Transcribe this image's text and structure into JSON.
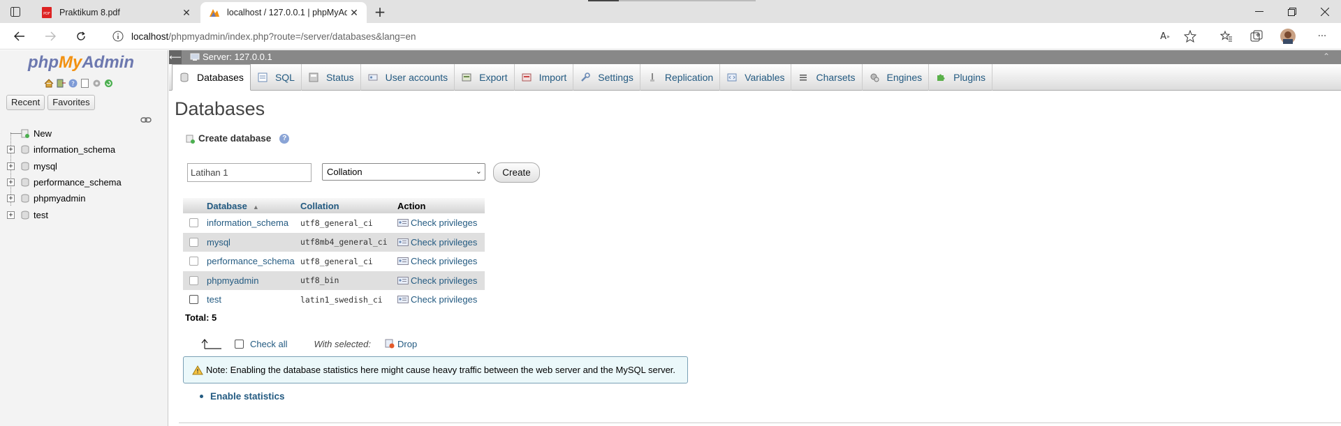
{
  "browser": {
    "tabs": [
      {
        "title": "Praktikum 8.pdf",
        "active": false
      },
      {
        "title": "localhost / 127.0.0.1 | phpMyAdmin",
        "active": true
      }
    ],
    "url_host": "localhost",
    "url_path": "/phpmyadmin/index.php?route=/server/databases&lang=en"
  },
  "nav": {
    "logo_php": "php",
    "logo_my": "My",
    "logo_admin": "Admin",
    "recent_label": "Recent",
    "favorites_label": "Favorites",
    "tree": [
      {
        "label": "New"
      },
      {
        "label": "information_schema"
      },
      {
        "label": "mysql"
      },
      {
        "label": "performance_schema"
      },
      {
        "label": "phpmyadmin"
      },
      {
        "label": "test"
      }
    ]
  },
  "server_bar": {
    "label": "Server: 127.0.0.1"
  },
  "main_tabs": [
    {
      "label": "Databases",
      "icon": "database-icon"
    },
    {
      "label": "SQL",
      "icon": "sql-icon"
    },
    {
      "label": "Status",
      "icon": "status-icon"
    },
    {
      "label": "User accounts",
      "icon": "users-icon"
    },
    {
      "label": "Export",
      "icon": "export-icon"
    },
    {
      "label": "Import",
      "icon": "import-icon"
    },
    {
      "label": "Settings",
      "icon": "settings-icon"
    },
    {
      "label": "Replication",
      "icon": "replication-icon"
    },
    {
      "label": "Variables",
      "icon": "variables-icon"
    },
    {
      "label": "Charsets",
      "icon": "charsets-icon"
    },
    {
      "label": "Engines",
      "icon": "engines-icon"
    },
    {
      "label": "Plugins",
      "icon": "plugins-icon"
    }
  ],
  "page": {
    "title": "Databases",
    "create_heading": "Create database",
    "db_name_value": "Latihan 1",
    "collation_value": "Collation",
    "create_button": "Create"
  },
  "table": {
    "headers": {
      "database": "Database",
      "collation": "Collation",
      "action": "Action"
    },
    "rows": [
      {
        "database": "information_schema",
        "collation": "utf8_general_ci",
        "action": "Check privileges"
      },
      {
        "database": "mysql",
        "collation": "utf8mb4_general_ci",
        "action": "Check privileges"
      },
      {
        "database": "performance_schema",
        "collation": "utf8_general_ci",
        "action": "Check privileges"
      },
      {
        "database": "phpmyadmin",
        "collation": "utf8_bin",
        "action": "Check privileges"
      },
      {
        "database": "test",
        "collation": "latin1_swedish_ci",
        "action": "Check privileges"
      }
    ],
    "total": "Total: 5"
  },
  "bulk": {
    "check_all": "Check all",
    "with_selected": "With selected:",
    "drop": "Drop"
  },
  "notice": {
    "text": "Note: Enabling the database statistics here might cause heavy traffic between the web server and the MySQL server."
  },
  "enable_statistics": "Enable statistics",
  "colors": {
    "link": "#235a81",
    "server_bar": "#888888",
    "notice_bg": "#ebf8fa"
  }
}
